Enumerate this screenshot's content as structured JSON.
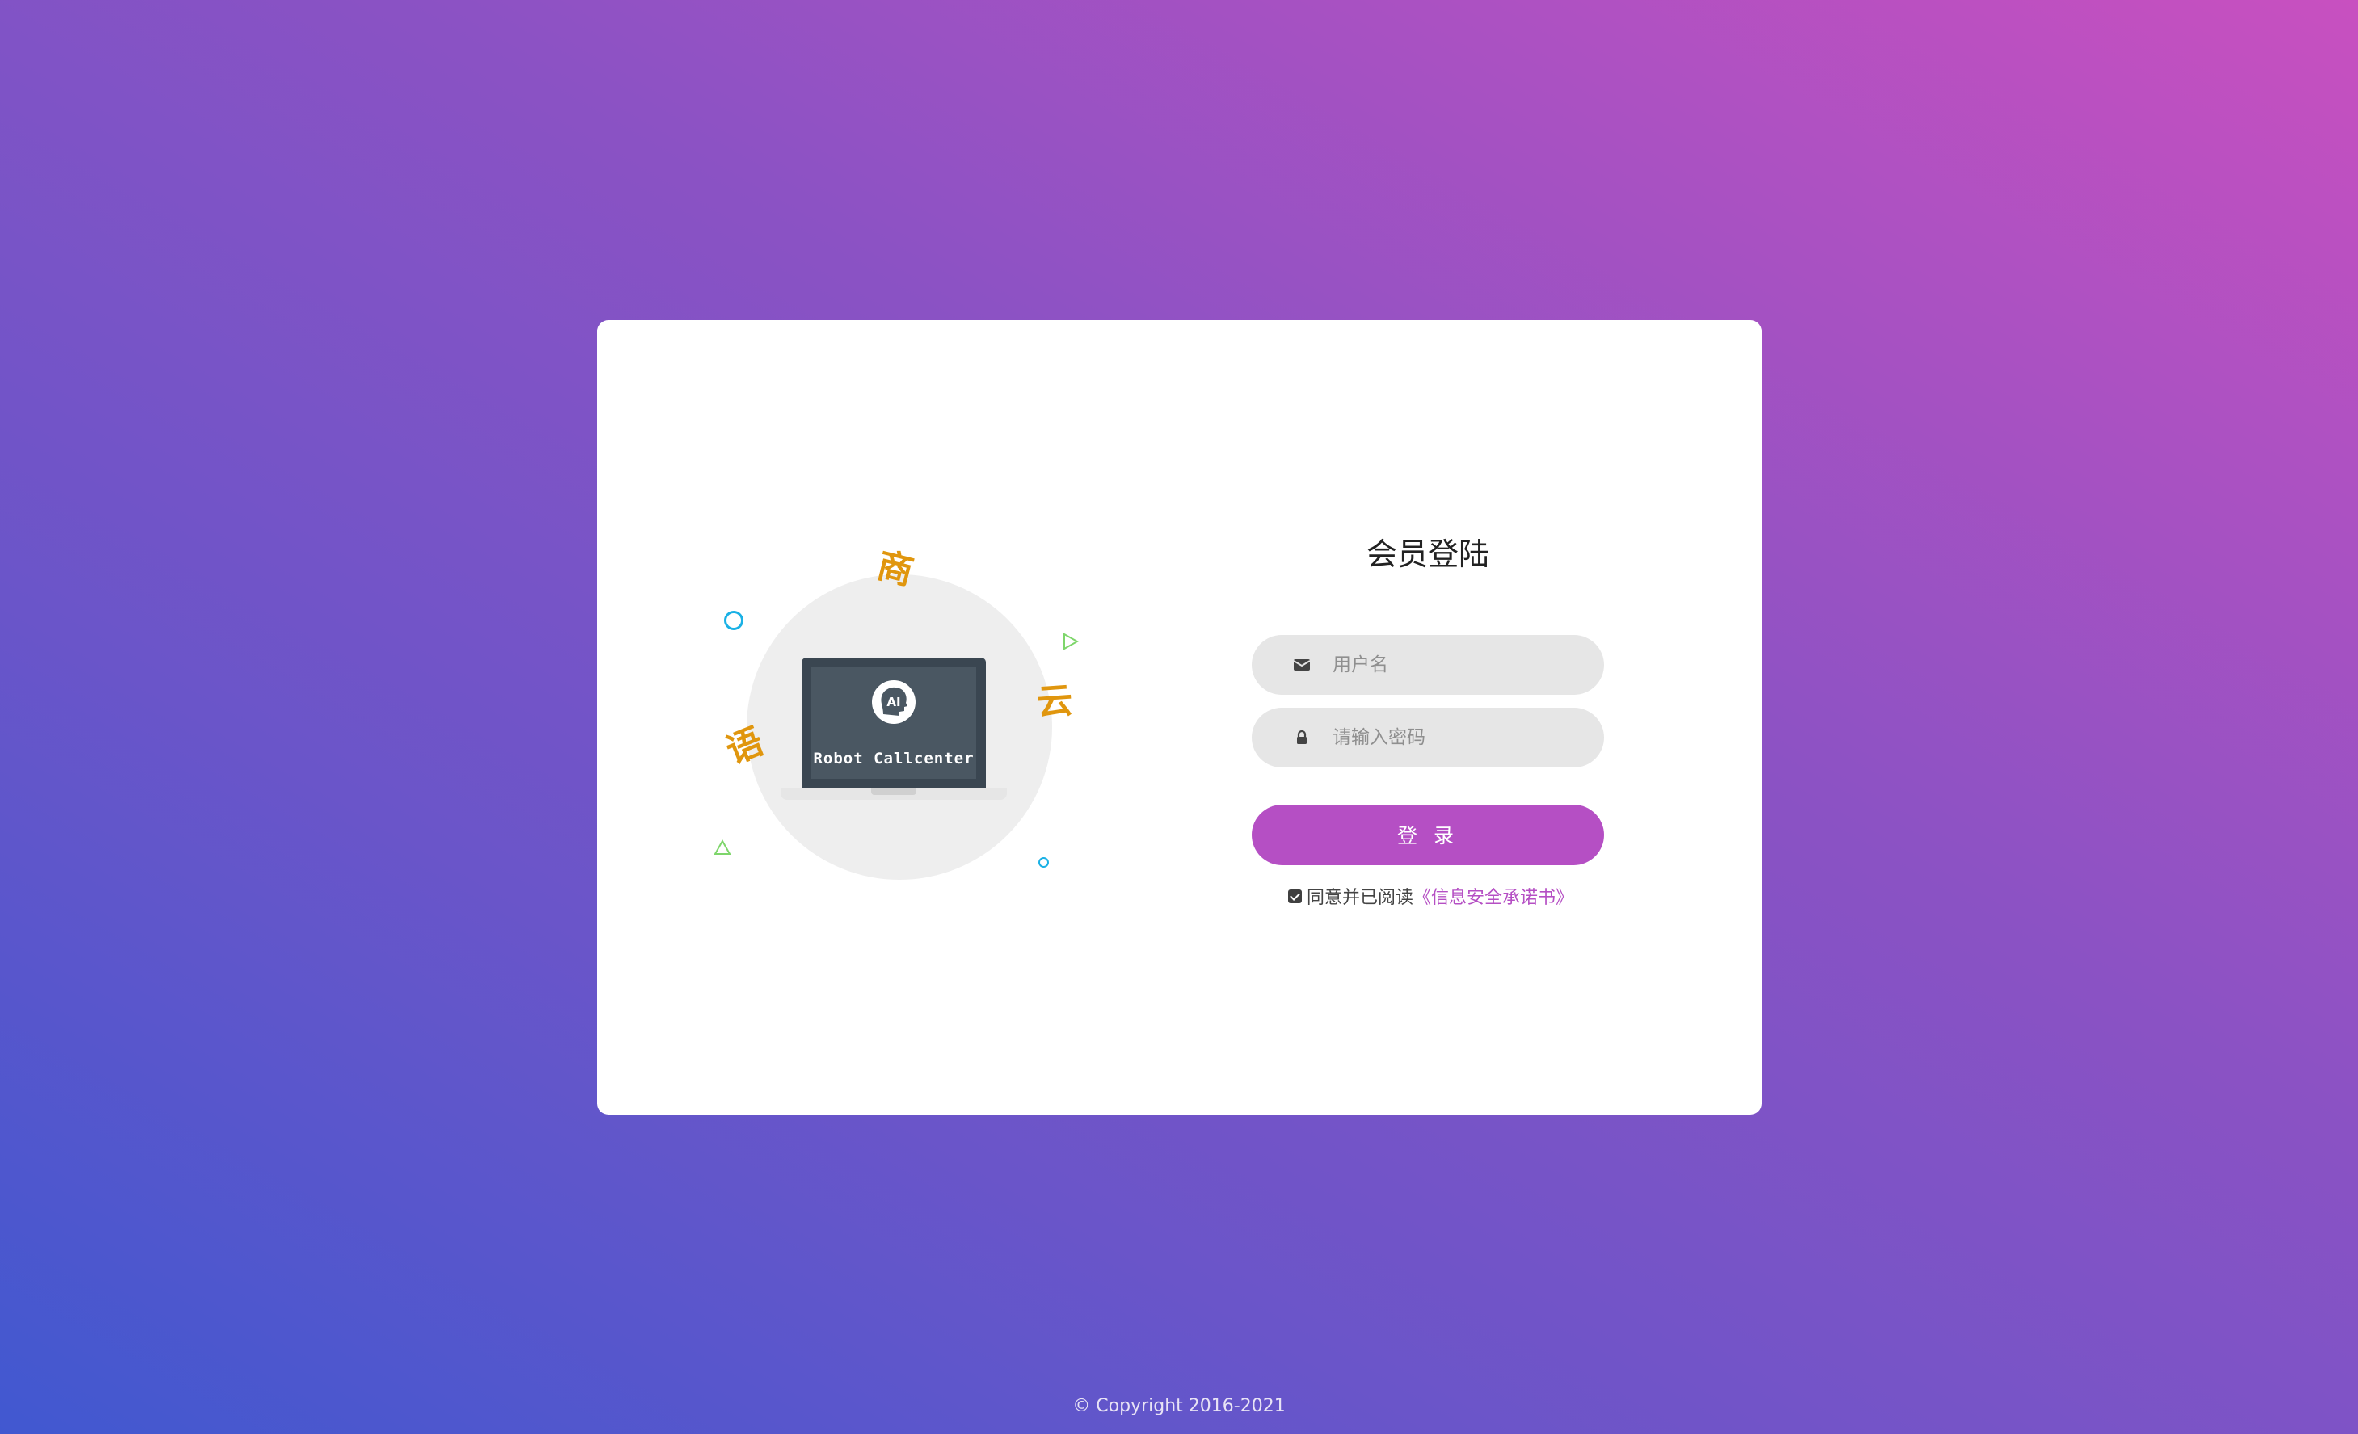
{
  "illustration": {
    "screen_text": "Robot Callcenter",
    "badge_text": "AI",
    "glyph_shang": "商",
    "glyph_yun": "云",
    "glyph_yu": "语"
  },
  "login": {
    "title": "会员登陆",
    "username_placeholder": "用户名",
    "password_placeholder": "请输入密码",
    "submit_label": "登 录",
    "agree_text": "同意并已阅读",
    "agree_link": "《信息安全承诺书》",
    "agree_checked": true
  },
  "footer": {
    "copyright": "© Copyright 2016-2021"
  },
  "colors": {
    "accent": "#b54fc4",
    "glyph": "#e0960e",
    "deco_blue": "#1ab1e5",
    "deco_green": "#7ed66b"
  }
}
